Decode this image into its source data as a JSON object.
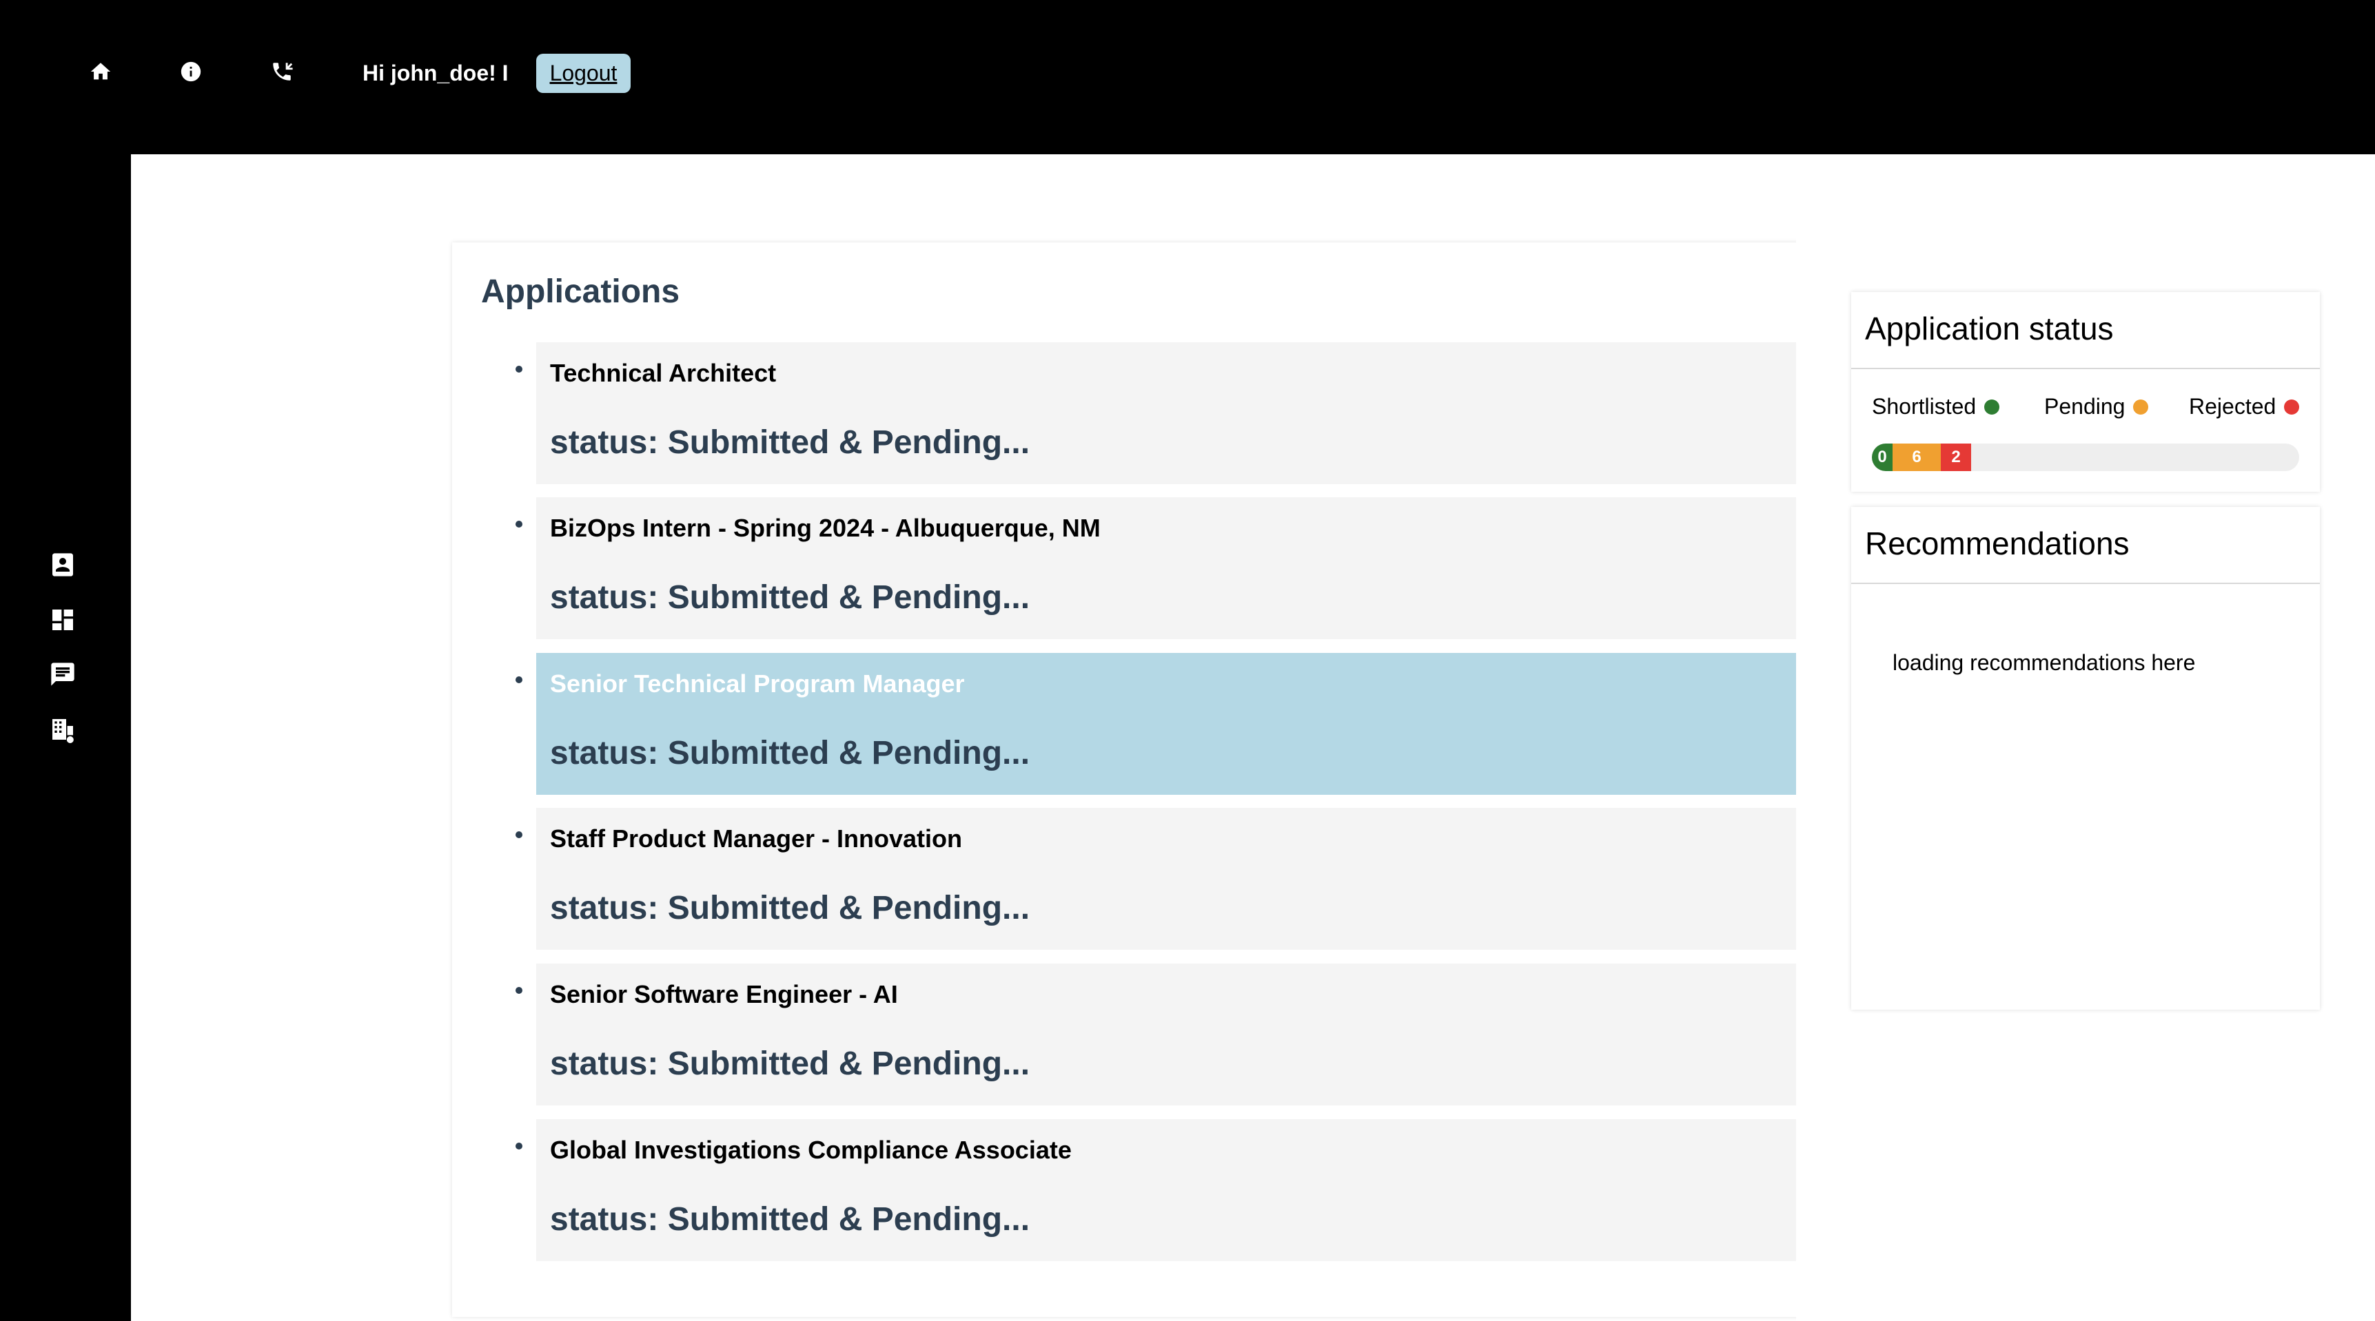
{
  "header": {
    "greeting": "Hi john_doe! I",
    "logout_label": "Logout",
    "icons": [
      "home-icon",
      "info-icon",
      "phone-callback-icon"
    ]
  },
  "sidebar": {
    "icons": [
      "contact-card-icon",
      "dashboard-icon",
      "chat-icon",
      "company-icon"
    ]
  },
  "applications": {
    "title": "Applications",
    "items": [
      {
        "title": "Technical Architect",
        "status": "status: Submitted & Pending...",
        "selected": false
      },
      {
        "title": "BizOps Intern - Spring 2024 - Albuquerque, NM",
        "status": "status: Submitted & Pending...",
        "selected": false
      },
      {
        "title": "Senior Technical Program Manager",
        "status": "status: Submitted & Pending...",
        "selected": true
      },
      {
        "title": "Staff Product Manager - Innovation",
        "status": "status: Submitted & Pending...",
        "selected": false
      },
      {
        "title": "Senior Software Engineer - AI",
        "status": "status: Submitted & Pending...",
        "selected": false
      },
      {
        "title": "Global Investigations Compliance Associate",
        "status": "status: Submitted & Pending...",
        "selected": false
      }
    ]
  },
  "application_status": {
    "title": "Application status",
    "legend": [
      {
        "label": "Shortlisted",
        "color": "#2e7d32"
      },
      {
        "label": "Pending",
        "color": "#f0a030"
      },
      {
        "label": "Rejected",
        "color": "#e53935"
      }
    ],
    "counts": {
      "shortlisted": "0",
      "pending": "6",
      "rejected": "2"
    }
  },
  "recommendations": {
    "title": "Recommendations",
    "text": "loading recommendations here"
  },
  "colors": {
    "selected_item": "#b4d8e5",
    "item_background": "#f4f4f4",
    "status_text": "#2c3e50"
  }
}
